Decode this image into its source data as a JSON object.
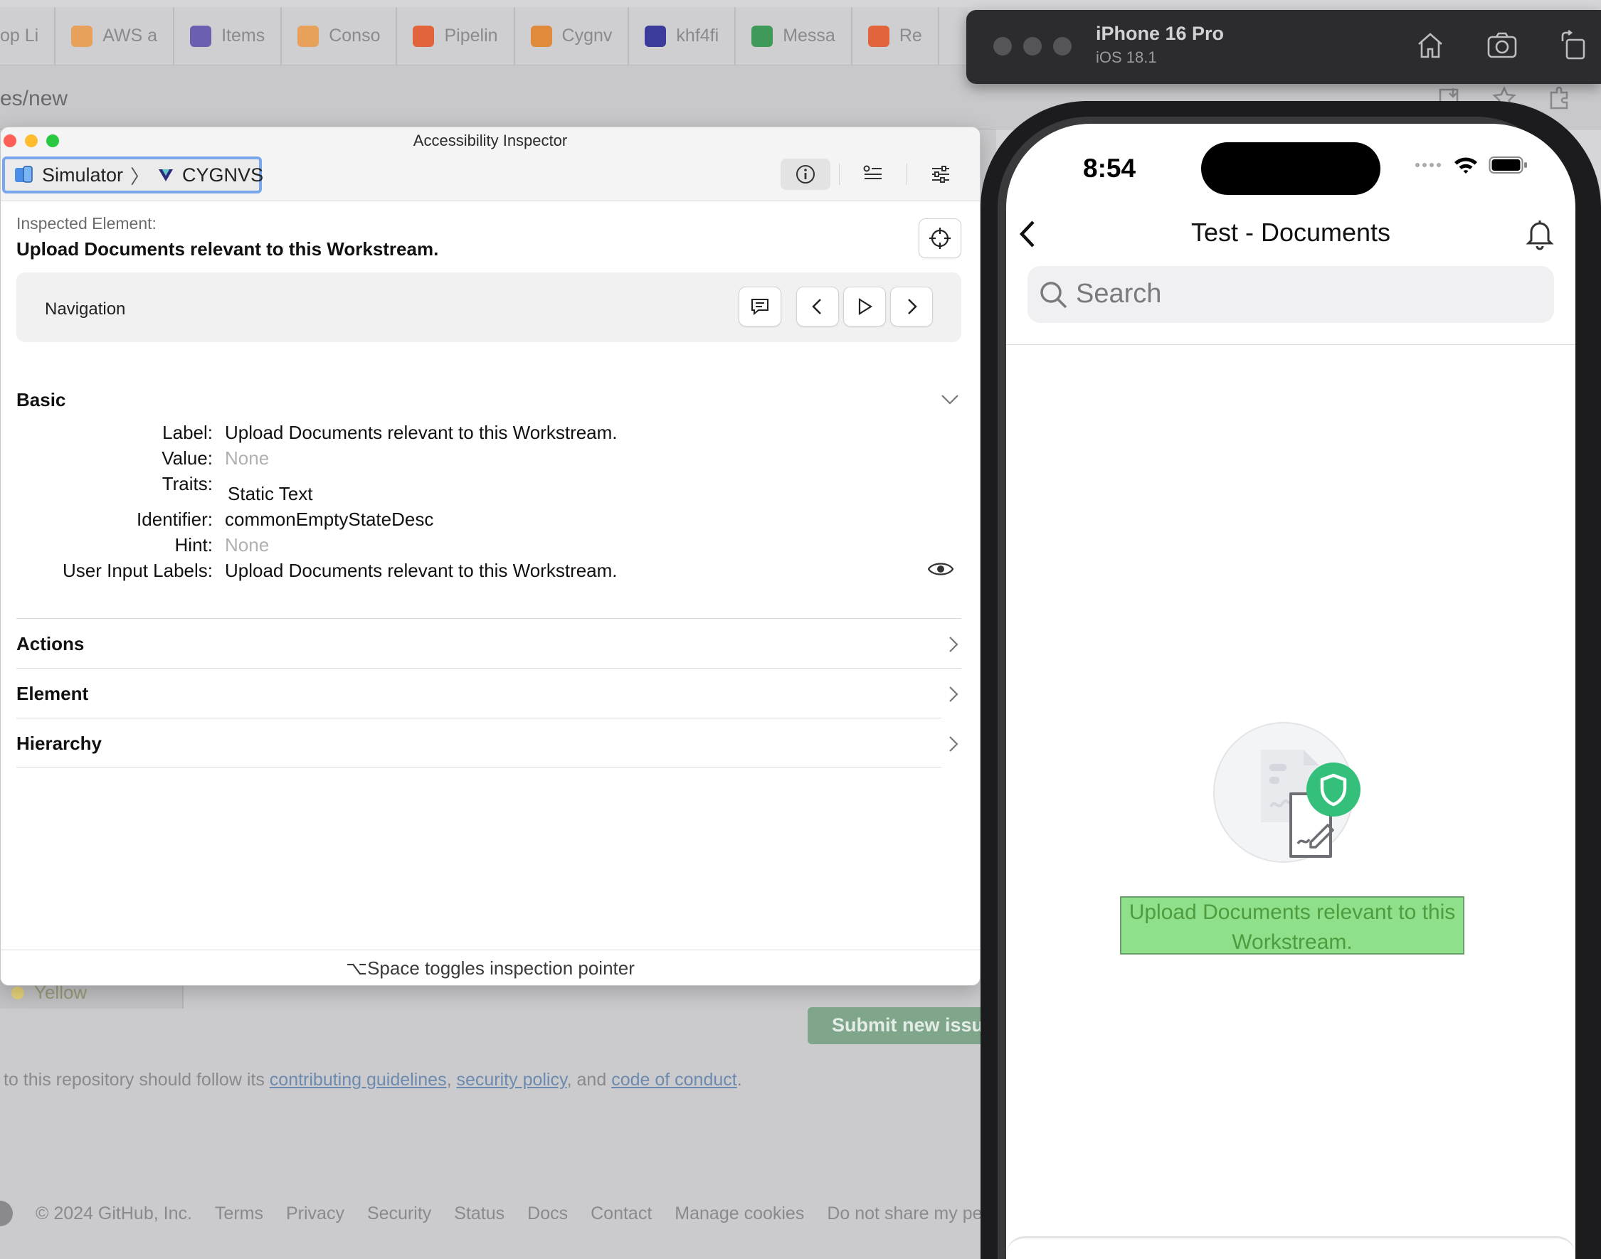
{
  "browser": {
    "tabs": [
      {
        "label": "op Li",
        "color": "#8aa0c8"
      },
      {
        "label": "AWS a",
        "color": "#e8a15a"
      },
      {
        "label": "Items",
        "color": "#6b5fb0"
      },
      {
        "label": "Conso",
        "color": "#e8a15a"
      },
      {
        "label": "Pipelin",
        "color": "#e2643d"
      },
      {
        "label": "Cygnv",
        "color": "#e08a3c"
      },
      {
        "label": "khf4fi",
        "color": "#3b3b9c"
      },
      {
        "label": "Messa",
        "color": "#3f9a5a"
      },
      {
        "label": "Re",
        "color": "#e2643d"
      }
    ],
    "url": "es/new"
  },
  "github": {
    "yellow_label": "Yellow",
    "submit_button": "Submit new issue",
    "repo_note_prefix": "to this repository should follow its",
    "repo_note_link1": "contributing guidelines",
    "repo_note_sep1": ",",
    "repo_note_link2": "security policy",
    "repo_note_sep2": ", and",
    "repo_note_link3": "code of conduct",
    "repo_note_end": ".",
    "footer": {
      "copyright": "© 2024 GitHub, Inc.",
      "links": [
        "Terms",
        "Privacy",
        "Security",
        "Status",
        "Docs",
        "Contact",
        "Manage cookies",
        "Do not share my pe"
      ]
    }
  },
  "inspector": {
    "title": "Accessibility Inspector",
    "target": {
      "app": "Simulator",
      "separator": "〉",
      "process": "CYGNVS"
    },
    "inspected_caption": "Inspected Element:",
    "inspected_name": "Upload Documents relevant to this Workstream.",
    "navigation_label": "Navigation",
    "basic_heading": "Basic",
    "attributes": [
      {
        "key": "Label:",
        "value": "Upload Documents relevant to this Workstream.",
        "muted": false
      },
      {
        "key": "Value:",
        "value": "None",
        "muted": true
      },
      {
        "key": "Traits:",
        "value": "Static Text",
        "muted": false
      },
      {
        "key": "Identifier:",
        "value": "commonEmptyStateDesc",
        "muted": false
      },
      {
        "key": "Hint:",
        "value": "None",
        "muted": true
      },
      {
        "key": "User Input Labels:",
        "value": "Upload Documents relevant to this Workstream.",
        "muted": false
      }
    ],
    "sections": [
      "Actions",
      "Element",
      "Hierarchy"
    ],
    "footer_hint": "⌥Space toggles inspection pointer"
  },
  "simulator": {
    "device": "iPhone 16 Pro",
    "os": "iOS 18.1"
  },
  "phone": {
    "time": "8:54",
    "nav_title": "Test - Documents",
    "search_placeholder": "Search",
    "empty_desc": "Upload Documents relevant to this Workstream."
  },
  "colors": {
    "highlight_green": "#8fe08a",
    "shield_green": "#34c07a",
    "focus_blue": "#7aa6ec"
  }
}
